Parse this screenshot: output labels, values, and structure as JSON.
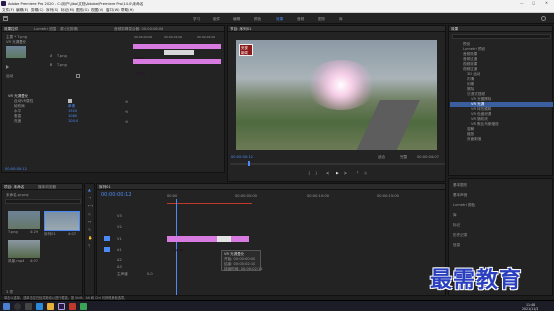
{
  "app": {
    "title": "Adobe Premiere Pro 2020 - C:\\用户\\jiba\\文档\\Adobe\\Premiere Pro\\14.0\\未命名"
  },
  "menu": [
    "文件(F)",
    "编辑(E)",
    "剪辑(C)",
    "序列(S)",
    "标记(M)",
    "图形(G)",
    "视图(V)",
    "窗口(W)",
    "帮助(H)"
  ],
  "workspaces": [
    "学习",
    "组件",
    "编辑",
    "颜色",
    "效果",
    "音频",
    "图形",
    "库"
  ],
  "active_workspace": "效果",
  "effect_controls": {
    "tabs": [
      "效果控件",
      "Lumetri 范围",
      "源:(无剪辑)",
      "音频剪辑混合器: 00:00:06:06"
    ],
    "master": "主要 * T.png",
    "clip": "T.png",
    "timecodes": [
      "00:00:00:00",
      "00:00:02:00",
      "00:00:04:00"
    ],
    "motion_label": "运动",
    "opacity_label": "不透明度",
    "time_remap": "时间重映射",
    "vr_label": "VR 光漏叠化",
    "props": [
      {
        "name": "自动VR属性",
        "value": ""
      },
      {
        "name": "帧布局",
        "value": "单像"
      },
      {
        "name": "水平",
        "value": "1920"
      },
      {
        "name": "垂直",
        "value": "1080"
      },
      {
        "name": "亮度",
        "value": "100.0"
      },
      {
        "name": "颜色",
        "value": ""
      },
      {
        "name": "亮度",
        "value": "2.0"
      },
      {
        "name": "漏光位置",
        "value": "0.0"
      },
      {
        "name": "漏光透明度",
        "value": "50.0"
      }
    ],
    "timecode_bottom": "00:00:00:12"
  },
  "program": {
    "tab": "节目: 序列01",
    "overlay_line1": "央视",
    "overlay_line2": "新闻",
    "timecode": "00:00:00:12",
    "fit": "适合",
    "quality": "完整",
    "duration": "00:00:04:07"
  },
  "effects_panel": {
    "tab": "效果",
    "tree": [
      "预设",
      "Lumetri 预设",
      "音频效果",
      "音频过渡",
      "视频效果",
      "视频过渡",
      "3D 运动",
      "内滑",
      "划像",
      "擦除",
      "沉浸式视频",
      "VR 光圈擦除",
      "VR 光漏",
      "VR 球形模糊",
      "VR 色度泄漏",
      "VR 随机块",
      "VR 默比乌斯缩放",
      "溶解",
      "缩放",
      "页面剥落"
    ],
    "selected": "VR 光漏"
  },
  "right_lower": [
    "基本图形",
    "基本声音",
    "Lumetri 颜色",
    "库",
    "标记",
    "历史记录",
    "信息"
  ],
  "project": {
    "tabs": [
      "项目: 未命名",
      "媒体浏览器"
    ],
    "path": "未命名.prproj",
    "items": [
      {
        "name": "T.png",
        "dur": "4:29"
      },
      {
        "name": "序列01",
        "dur": "4:07"
      },
      {
        "name": "风景.mp4",
        "dur": "4:07"
      }
    ],
    "count": "3 项"
  },
  "timeline": {
    "tab": "序列01",
    "timecode": "00:00:00:12",
    "ruler": [
      "00:00",
      "00:00:05:00",
      "00:00:10:00",
      "00:00:15:00"
    ],
    "tracks": [
      "V3",
      "V2",
      "V1",
      "A1",
      "A2",
      "A3",
      "主声道"
    ],
    "clip_v1_a": "T.png",
    "clip_v1_b": "T.png",
    "tooltip": [
      "VR 光漏叠化",
      "开始: 00:00:00:00",
      "结束: 00:00:02:10",
      "持续时间: 00:00:02:11"
    ],
    "master_value": "0.0"
  },
  "taskbar": {
    "time": "11:48",
    "date": "2021/11/2"
  },
  "watermark": "最需教育",
  "status": "单击以选择，或单击空白处并拖动以进行框选。按 Shift、Alt 和 Ctrl 可获得其他选项。"
}
